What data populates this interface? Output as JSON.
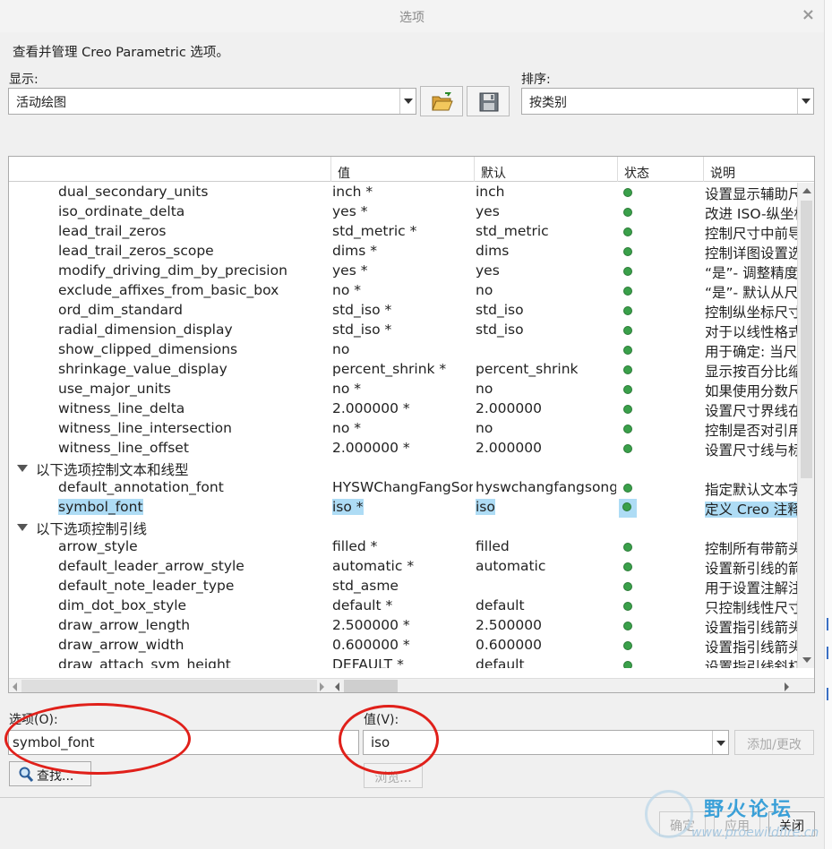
{
  "window": {
    "title": "选项",
    "close_glyph": "×"
  },
  "intro": "查看并管理 Creo Parametric 选项。",
  "show": {
    "label": "显示:",
    "value": "活动绘图"
  },
  "sort": {
    "label": "排序:",
    "value": "按类别"
  },
  "table": {
    "headers": [
      "",
      "值",
      "默认",
      "状态",
      "说明"
    ],
    "rows": [
      {
        "name": "dual_secondary_units",
        "value": "inch *",
        "default": "inch",
        "desc": "设置显示辅助尺"
      },
      {
        "name": "iso_ordinate_delta",
        "value": "yes *",
        "default": "yes",
        "desc": "改进 ISO-纵坐标"
      },
      {
        "name": "lead_trail_zeros",
        "value": "std_metric *",
        "default": "std_metric",
        "desc": "控制尺寸中前导"
      },
      {
        "name": "lead_trail_zeros_scope",
        "value": "dims *",
        "default": "dims",
        "desc": "控制详图设置选"
      },
      {
        "name": "modify_driving_dim_by_precision",
        "value": "yes *",
        "default": "yes",
        "desc": "“是”- 调整精度时"
      },
      {
        "name": "exclude_affixes_from_basic_box",
        "value": "no *",
        "default": "no",
        "desc": "“是”- 默认从尺寸"
      },
      {
        "name": "ord_dim_standard",
        "value": "std_iso *",
        "default": "std_iso",
        "desc": "控制纵坐标尺寸"
      },
      {
        "name": "radial_dimension_display",
        "value": "std_iso *",
        "default": "std_iso",
        "desc": "对于以线性格式"
      },
      {
        "name": "show_clipped_dimensions",
        "value": "no",
        "default": "",
        "desc": "用于确定: 当尺寸"
      },
      {
        "name": "shrinkage_value_display",
        "value": "percent_shrink *",
        "default": "percent_shrink",
        "desc": "显示按百分比缩"
      },
      {
        "name": "use_major_units",
        "value": "no *",
        "default": "no",
        "desc": "如果使用分数尺"
      },
      {
        "name": "witness_line_delta",
        "value": "2.000000 *",
        "default": "2.000000",
        "desc": "设置尺寸界线在"
      },
      {
        "name": "witness_line_intersection",
        "value": "no *",
        "default": "no",
        "desc": "控制是否对引用"
      },
      {
        "name": "witness_line_offset",
        "value": "2.000000 *",
        "default": "2.000000",
        "desc": "设置尺寸线与标"
      },
      {
        "group": "以下选项控制文本和线型"
      },
      {
        "name": "default_annotation_font",
        "value": "HYSWChangFangSong",
        "default": "hyswchangfangsong.",
        "desc": "指定默认文本字"
      },
      {
        "name": "symbol_font",
        "value": "iso *",
        "default": "iso",
        "desc": "定义 Creo 注释",
        "selected": true
      },
      {
        "group": "以下选项控制引线"
      },
      {
        "name": "arrow_style",
        "value": "filled *",
        "default": "filled",
        "desc": "控制所有带箭头"
      },
      {
        "name": "default_leader_arrow_style",
        "value": "automatic *",
        "default": "automatic",
        "desc": "设置新引线的箭"
      },
      {
        "name": "default_note_leader_type",
        "value": "std_asme",
        "default": "",
        "desc": "用于设置注解注"
      },
      {
        "name": "dim_dot_box_style",
        "value": "default *",
        "default": "default",
        "desc": "只控制线性尺寸"
      },
      {
        "name": "draw_arrow_length",
        "value": "2.500000 *",
        "default": "2.500000",
        "desc": "设置指引线箭头"
      },
      {
        "name": "draw_arrow_width",
        "value": "0.600000 *",
        "default": "0.600000",
        "desc": "设置指引线箭头"
      },
      {
        "name": "draw_attach_sym_height",
        "value": "DEFAULT *",
        "default": "default",
        "desc": "设置指引线斜杠"
      }
    ]
  },
  "option": {
    "label": "选项(O):",
    "value": "symbol_font"
  },
  "value_field": {
    "label": "值(V):",
    "value": "iso"
  },
  "buttons": {
    "add_change": "添加/更改",
    "find": "查找...",
    "browse": "浏览...",
    "ok": "确定",
    "apply": "应用",
    "close": "关闭"
  },
  "watermark": {
    "title": "野火论坛",
    "url": "www.proewildfire.cn"
  },
  "colors": {
    "status_dot": "#3aa04a",
    "selection": "#aedcf5",
    "annotation_circle": "#e0201a"
  }
}
